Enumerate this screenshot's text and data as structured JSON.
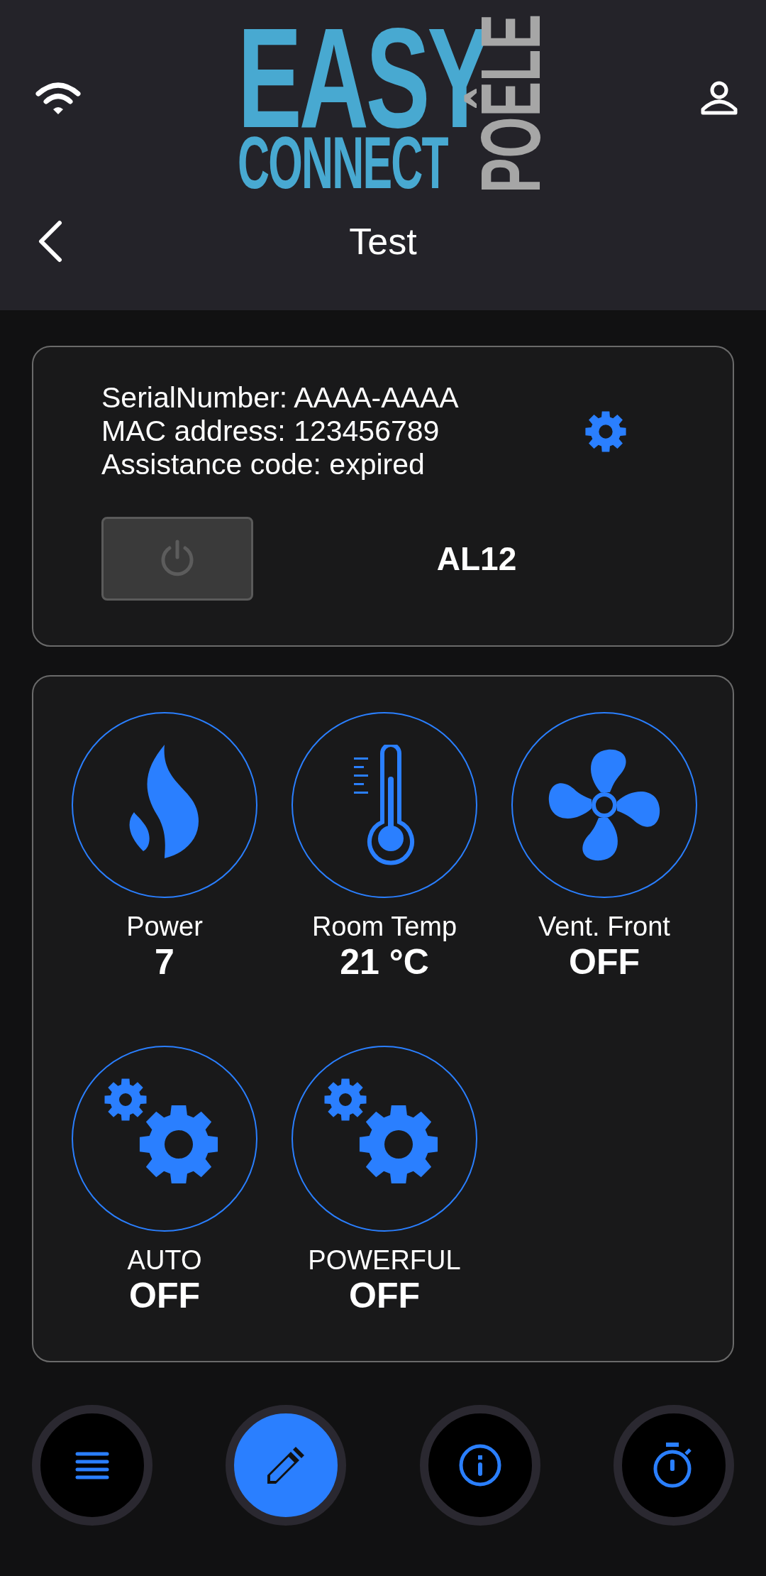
{
  "header": {
    "logo": {
      "line_1": "EASY",
      "line_2": "CONNECT",
      "side": "POÊLE"
    },
    "title": "Test"
  },
  "device": {
    "info_lines": [
      "SerialNumber: AAAA-AAAA",
      "MAC address: 123456789",
      "Assistance code: expired"
    ],
    "power_button": {
      "disabled": true
    },
    "alarm": "AL12"
  },
  "tiles": [
    {
      "kind": "flame",
      "label": "Power",
      "value": "7"
    },
    {
      "kind": "thermometer",
      "label": "Room Temp",
      "value": "21 °C"
    },
    {
      "kind": "fan",
      "label": "Vent. Front",
      "value": "OFF"
    },
    {
      "kind": "gears",
      "label": "AUTO",
      "value": "OFF"
    },
    {
      "kind": "gears",
      "label": "POWERFUL",
      "value": "OFF"
    }
  ],
  "nav": [
    {
      "kind": "menu",
      "selected": false
    },
    {
      "kind": "pencil",
      "selected": true
    },
    {
      "kind": "info",
      "selected": false
    },
    {
      "kind": "timer",
      "selected": false
    }
  ]
}
